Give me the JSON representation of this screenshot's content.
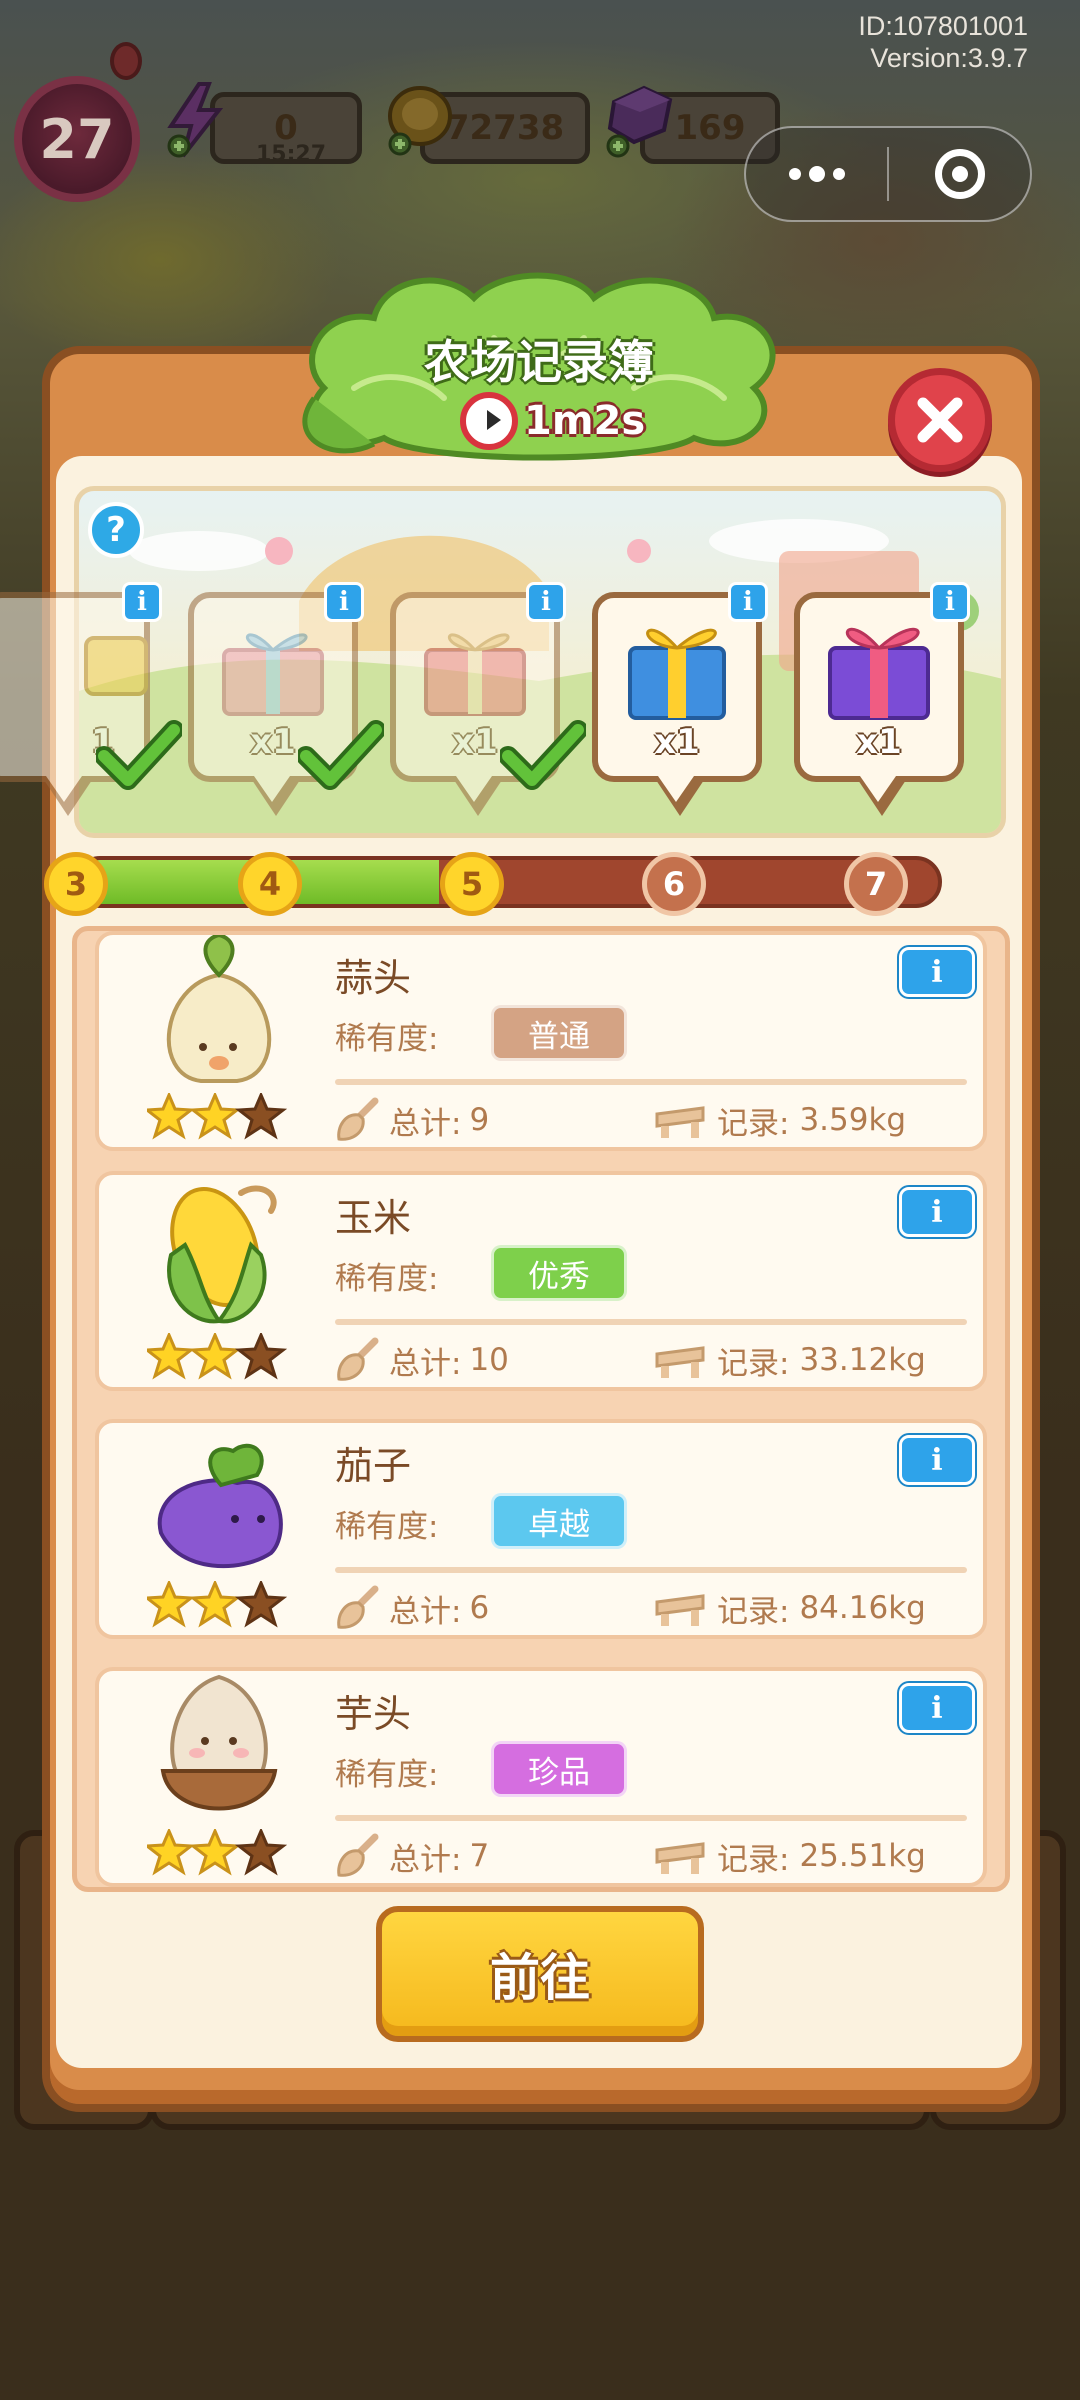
{
  "hud": {
    "id_line": "ID:107801001",
    "version_line": "Version:3.9.7",
    "level": "27",
    "energy_value": "0",
    "energy_timer": "15:27",
    "coins_value": "72738",
    "gems_value": "169"
  },
  "modal": {
    "title": "农场记录簿",
    "timer": "1m2s",
    "help_glyph": "?",
    "info_glyph": "i",
    "close_glyph": "✕"
  },
  "rewards": [
    {
      "qty": "1",
      "claimed": true,
      "gift": "gold-box"
    },
    {
      "qty": "x1",
      "claimed": true,
      "gift": "blue-gift"
    },
    {
      "qty": "x1",
      "claimed": true,
      "gift": "red-gift"
    },
    {
      "qty": "x1",
      "claimed": false,
      "gift": "gold-blue-gift"
    },
    {
      "qty": "x1",
      "claimed": false,
      "gift": "pink-purple-gift"
    }
  ],
  "progress": {
    "nodes": [
      "3",
      "4",
      "5",
      "6",
      "7"
    ],
    "reached": [
      "3",
      "4",
      "5"
    ],
    "fill_fraction": 0.42
  },
  "crops": [
    {
      "name": "蒜头",
      "rarity_label": "稀有度:",
      "rarity": "普通",
      "rarity_color": "#d4a384",
      "total_label": "总计:",
      "total": "9",
      "record_label": "记录:",
      "record": "3.59kg",
      "stars": 2,
      "art": "garlic-icon"
    },
    {
      "name": "玉米",
      "rarity_label": "稀有度:",
      "rarity": "优秀",
      "rarity_color": "#7ed04b",
      "total_label": "总计:",
      "total": "10",
      "record_label": "记录:",
      "record": "33.12kg",
      "stars": 2,
      "art": "corn-icon"
    },
    {
      "name": "茄子",
      "rarity_label": "稀有度:",
      "rarity": "卓越",
      "rarity_color": "#5cc8ef",
      "total_label": "总计:",
      "total": "6",
      "record_label": "记录:",
      "record": "84.16kg",
      "stars": 2,
      "art": "eggplant-icon"
    },
    {
      "name": "芋头",
      "rarity_label": "稀有度:",
      "rarity": "珍品",
      "rarity_color": "#d56ee0",
      "total_label": "总计:",
      "total": "7",
      "record_label": "记录:",
      "record": "25.51kg",
      "stars": 2,
      "art": "taro-icon"
    }
  ],
  "go_button": "前往",
  "colors": {
    "info_blue": "#2ea3ea",
    "close_red": "#e0434b",
    "progress_green": "#7cc52f",
    "progress_track": "#a0462e",
    "node_gold": "#ffd52b",
    "button_gold": "#f5b81c",
    "modal_frame": "#d98c4a"
  }
}
